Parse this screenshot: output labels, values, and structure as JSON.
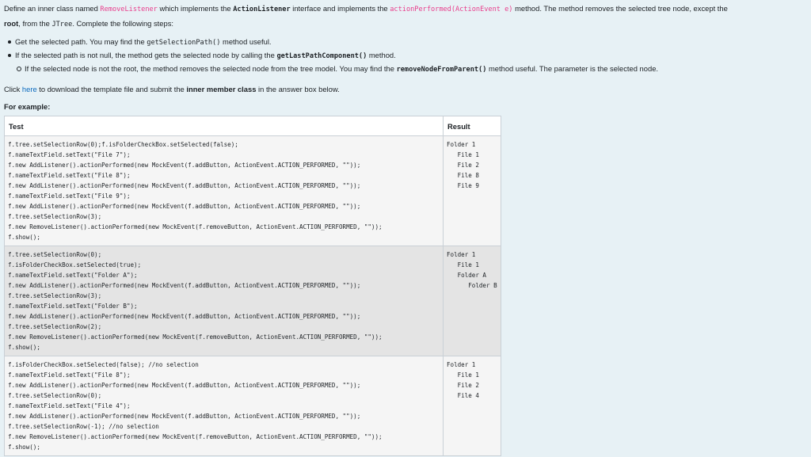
{
  "intro": {
    "t1": "Define an inner class named ",
    "class_name": "RemoveListener",
    "t2": " which implements the ",
    "interface_name": "ActionListener",
    "t3": " interface and implements the ",
    "method_sig": "actionPerformed(ActionEvent e)",
    "t4": " method. The method removes the selected tree node, except the ",
    "root_word": "root",
    "t5": ", from the ",
    "jtree": "JTree",
    "t6": ". Complete the following steps:"
  },
  "steps": {
    "s1_a": "Get the selected path. You may find the ",
    "s1_code": "getSelectionPath()",
    "s1_b": " method useful.",
    "s2_a": "If the selected path is not null, the method gets the selected node by calling the ",
    "s2_code": "getLastPathComponent()",
    "s2_b": " method.",
    "s3_a": "If the selected node is not the root, the method removes the selected node from the tree model. You may find the ",
    "s3_code": "removeNodeFromParent()",
    "s3_b": " method useful. The parameter is the selected node."
  },
  "click": {
    "a": "Click ",
    "link": "here",
    "b": " to download the template file and submit the ",
    "bold": "inner member class",
    "c": " in the answer box below."
  },
  "example_label": "For example:",
  "table": {
    "headers": {
      "test": "Test",
      "result": "Result"
    },
    "rows": [
      {
        "test": [
          "f.tree.setSelectionRow(0);f.isFolderCheckBox.setSelected(false);",
          "f.nameTextField.setText(\"File 7\");",
          "f.new AddListener().actionPerformed(new MockEvent(f.addButton, ActionEvent.ACTION_PERFORMED, \"\"));",
          "f.nameTextField.setText(\"File 8\");",
          "f.new AddListener().actionPerformed(new MockEvent(f.addButton, ActionEvent.ACTION_PERFORMED, \"\"));",
          "f.nameTextField.setText(\"File 9\");",
          "f.new AddListener().actionPerformed(new MockEvent(f.addButton, ActionEvent.ACTION_PERFORMED, \"\"));",
          "f.tree.setSelectionRow(3);",
          "f.new RemoveListener().actionPerformed(new MockEvent(f.removeButton, ActionEvent.ACTION_PERFORMED, \"\"));",
          "f.show();"
        ],
        "result": [
          "Folder 1",
          "   File 1",
          "   File 2",
          "   File 8",
          "   File 9"
        ]
      },
      {
        "test": [
          "f.tree.setSelectionRow(0);",
          "f.isFolderCheckBox.setSelected(true);",
          "f.nameTextField.setText(\"Folder A\");",
          "f.new AddListener().actionPerformed(new MockEvent(f.addButton, ActionEvent.ACTION_PERFORMED, \"\"));",
          "f.tree.setSelectionRow(3);",
          "f.nameTextField.setText(\"Folder B\");",
          "f.new AddListener().actionPerformed(new MockEvent(f.addButton, ActionEvent.ACTION_PERFORMED, \"\"));",
          "f.tree.setSelectionRow(2);",
          "f.new RemoveListener().actionPerformed(new MockEvent(f.removeButton, ActionEvent.ACTION_PERFORMED, \"\"));",
          "f.show();"
        ],
        "result": [
          "Folder 1",
          "   File 1",
          "   Folder A",
          "      Folder B"
        ]
      },
      {
        "test": [
          "f.isFolderCheckBox.setSelected(false); //no selection",
          "f.nameTextField.setText(\"File 8\");",
          "f.new AddListener().actionPerformed(new MockEvent(f.addButton, ActionEvent.ACTION_PERFORMED, \"\"));",
          "f.tree.setSelectionRow(0);",
          "f.nameTextField.setText(\"File 4\");",
          "f.new AddListener().actionPerformed(new MockEvent(f.addButton, ActionEvent.ACTION_PERFORMED, \"\"));",
          "f.tree.setSelectionRow(-1); //no selection",
          "f.new RemoveListener().actionPerformed(new MockEvent(f.removeButton, ActionEvent.ACTION_PERFORMED, \"\"));",
          "f.show();"
        ],
        "result": [
          "Folder 1",
          "   File 1",
          "   File 2",
          "   File 4"
        ]
      }
    ]
  }
}
